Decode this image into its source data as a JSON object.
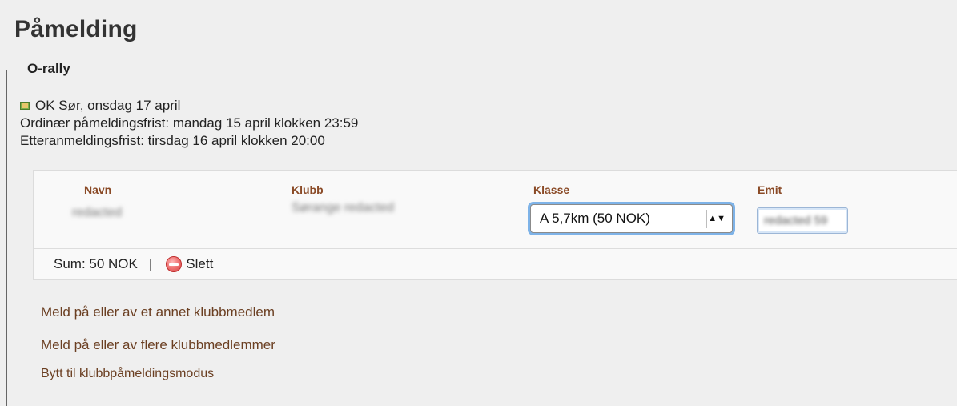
{
  "page": {
    "title": "Påmelding"
  },
  "event": {
    "section_title": "O-rally",
    "location_date": "OK Sør, onsdag 17 april",
    "regular_deadline": "Ordinær påmeldingsfrist: mandag 15 april klokken 23:59",
    "late_deadline": "Etteranmeldingsfrist: tirsdag 16 april klokken 20:00",
    "icon": "mail-icon"
  },
  "entry": {
    "labels": {
      "name": "Navn",
      "club": "Klubb",
      "class": "Klasse",
      "emit": "Emit"
    },
    "values": {
      "name": "redacted",
      "club": "Sørange redacted",
      "class": "A 5,7km (50 NOK)",
      "emit": "redacted 59"
    },
    "select_arrows": "▲▼"
  },
  "summary": {
    "sum": "Sum: 50 NOK",
    "separator": "|",
    "delete": "Slett",
    "delete_icon": "remove-icon"
  },
  "links": {
    "other_member": "Meld på eller av et annet klubbmedlem",
    "more_members": "Meld på eller av flere klubbmedlemmer",
    "club_mode": "Bytt til klubbpåmeldingsmodus"
  },
  "colors": {
    "background": "#efefef",
    "label_color": "#8a4a26",
    "link_color": "#6b3f22",
    "focus_ring": "#7eb3e8"
  }
}
